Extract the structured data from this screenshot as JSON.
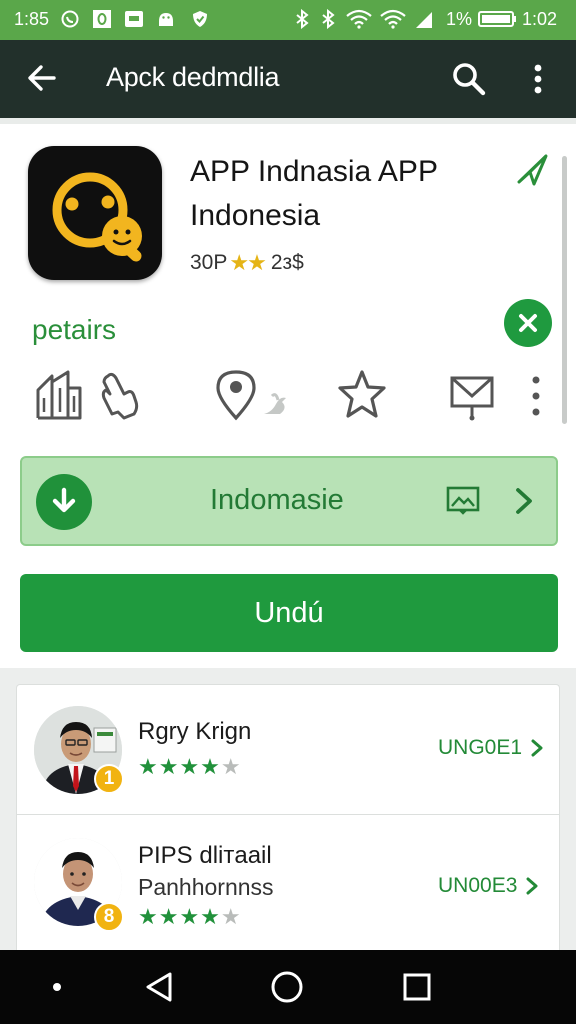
{
  "status_bar": {
    "time_left": "1:85",
    "battery_percent": "1%",
    "time_right": "1:02",
    "icons": [
      "whatsapp-icon",
      "o-square-icon",
      "message-square-icon",
      "android-icon",
      "shield-icon",
      "bluetooth-icon",
      "bluetooth-icon",
      "wifi-icon",
      "wifi-icon",
      "cell-signal-icon",
      "battery-icon"
    ]
  },
  "app_bar": {
    "title": "Apck dedmdlia",
    "icons": [
      "back-arrow-icon",
      "search-icon",
      "overflow-menu-icon"
    ]
  },
  "app": {
    "name": "APP Indnasia APP Indonesia",
    "rating_prefix": "30P",
    "rating_stars": "★★",
    "rating_suffix": "2з$",
    "category": "petairs",
    "share_icon": "send-icon",
    "close_icon": "close-icon"
  },
  "action_icons": [
    "building-icon",
    "hand-pointer-icon",
    "location-pin-icon",
    "bird-icon",
    "star-outline-icon",
    "inbox-icon",
    "more-vertical-icon"
  ],
  "install_banner": {
    "label": "Indomasie",
    "icons": [
      "download-icon",
      "image-icon",
      "chevron-right-icon"
    ]
  },
  "primary_button": {
    "label": "Undú"
  },
  "reviews": [
    {
      "name": "Rgry Krign",
      "subtitle": "",
      "rank": "1",
      "stars_filled": 4,
      "stars_total": 5,
      "stars_on": "★★★★",
      "stars_off": "★",
      "link": "UNG0E1"
    },
    {
      "name": "PIPS dliтaail",
      "subtitle": "Panhhornnss",
      "rank": "8",
      "stars_filled": 4,
      "stars_total": 5,
      "stars_on": "★★★★",
      "stars_off": "★",
      "link": "UN00E3"
    }
  ],
  "colors": {
    "status_bar": "#5aa74a",
    "app_bar": "#22302b",
    "accent_green": "#1f9a3e",
    "banner_green": "#b8e2b6",
    "star_gold": "#e5b416",
    "badge_gold": "#f1b311"
  },
  "nav_bar": {
    "icons": [
      "dot-icon",
      "back-triangle-icon",
      "home-circle-icon",
      "recents-square-icon"
    ]
  }
}
